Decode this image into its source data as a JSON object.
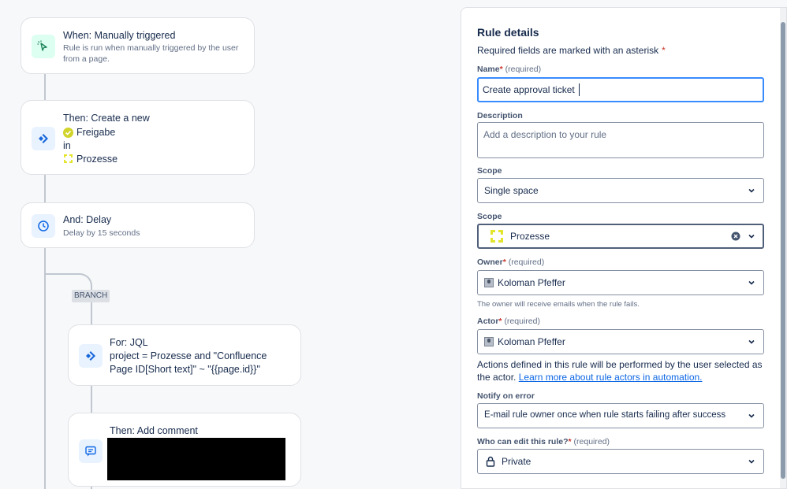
{
  "flow": {
    "trigger": {
      "title": "When: Manually triggered",
      "subtitle": "Rule is run when manually triggered by the user from a page."
    },
    "create": {
      "title": "Then: Create a new",
      "work_type": "Freigabe",
      "in_label": "in",
      "space": "Prozesse"
    },
    "delay": {
      "title": "And: Delay",
      "subtitle": "Delay by 15 seconds"
    },
    "branch_label": "BRANCH",
    "for_jql": {
      "title": "For: JQL",
      "query": "project = Prozesse and \"Confluence Page ID[Short text]\" ~ \"{{page.id}}\""
    },
    "comment": {
      "title": "Then: Add comment"
    }
  },
  "panel": {
    "title": "Rule details",
    "required_note": "Required fields are marked with an asterisk",
    "asterisk": "*",
    "required_label": "(required)",
    "name": {
      "label": "Name",
      "value": "Create approval ticket"
    },
    "description": {
      "label": "Description",
      "placeholder": "Add a description to your rule"
    },
    "scope_type": {
      "label": "Scope",
      "value": "Single space"
    },
    "scope_space": {
      "label": "Scope",
      "value": "Prozesse"
    },
    "owner": {
      "label": "Owner",
      "value": "Koloman Pfeffer",
      "help": "The owner will receive emails when the rule fails."
    },
    "actor": {
      "label": "Actor",
      "value": "Koloman Pfeffer",
      "help_text": "Actions defined in this rule will be performed by the user selected as the actor.",
      "help_link": "Learn more about rule actors in automation."
    },
    "notify": {
      "label": "Notify on error",
      "value": "E-mail rule owner once when rule starts failing after success"
    },
    "who_can_edit": {
      "label": "Who can edit this rule?",
      "value": "Private"
    }
  },
  "colors": {
    "accent": "#0c66e4",
    "focus": "#388bff",
    "required": "#c9372c",
    "trigger_icon_bg": "#dcfff1",
    "jira_blue": "#1868db",
    "delay_icon_bg": "#e9f2ff",
    "space_yellow": "#e2e52c",
    "approved_yellow": "#d1d42a"
  },
  "icons": {
    "trigger": "cursor-click-icon",
    "create": "jira-icon",
    "delay": "clock-icon",
    "for_jql": "jira-icon",
    "comment": "comment-icon",
    "freigabe": "check-circle-icon",
    "space": "space-logo-icon",
    "clear": "clear-icon",
    "chevron": "chevron-down-icon",
    "lock": "lock-icon",
    "avatar": "avatar-icon"
  }
}
